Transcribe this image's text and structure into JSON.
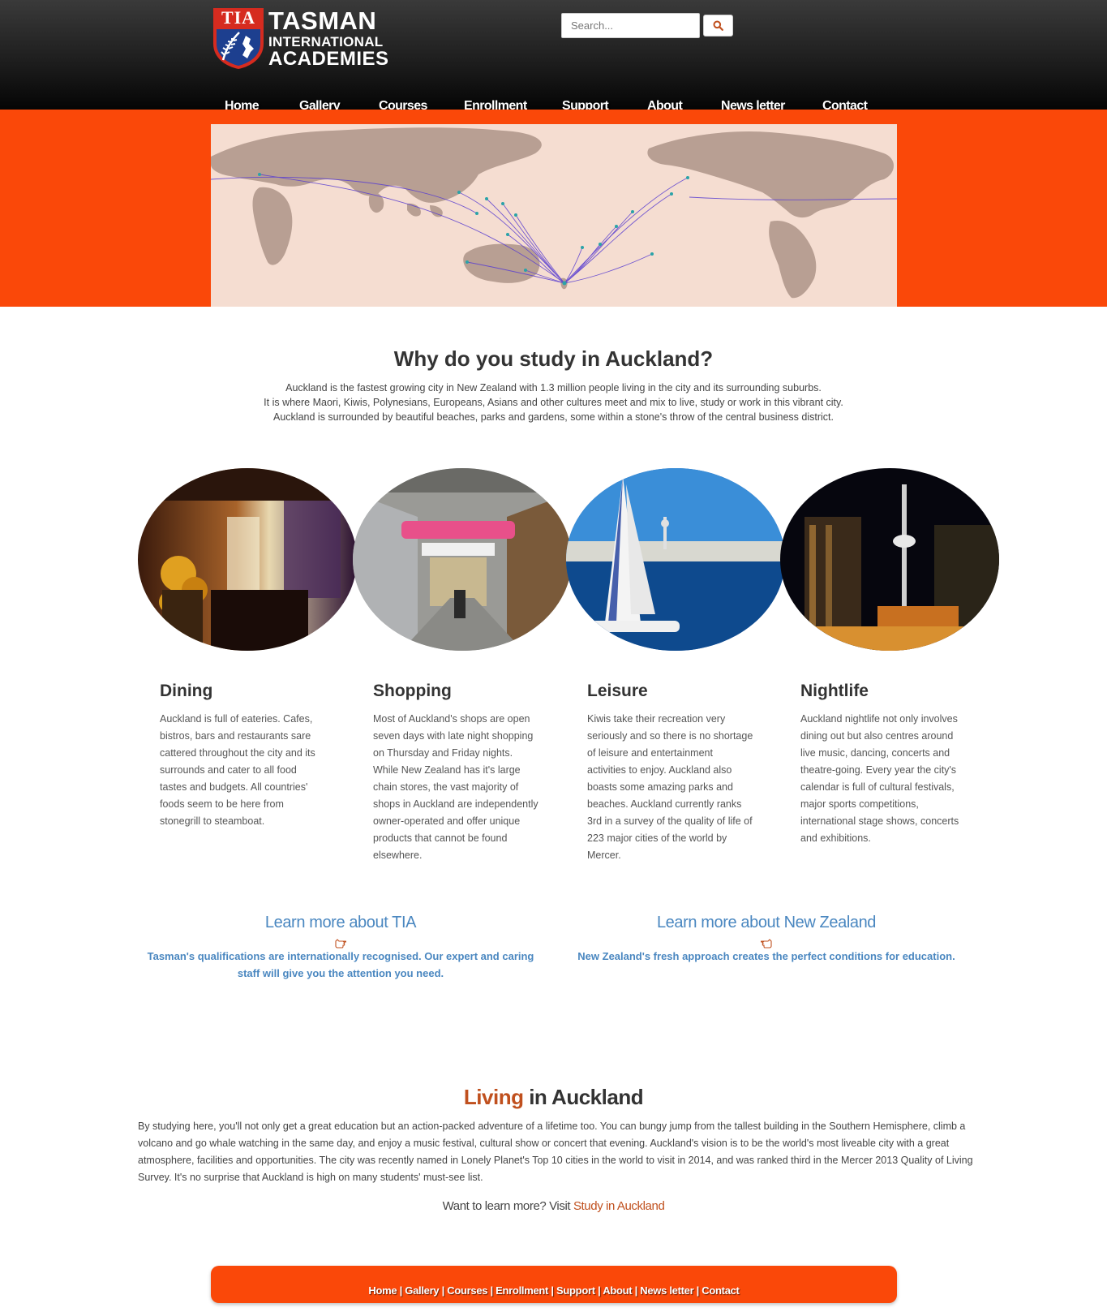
{
  "header": {
    "logo": {
      "badge": "TIA",
      "line1": "TASMAN",
      "line2": "INTERNATIONAL",
      "line3": "ACADEMIES"
    },
    "search": {
      "placeholder": "Search...",
      "button_icon": "search-icon"
    },
    "nav": [
      "Home",
      "Gallery",
      "Courses",
      "Enrollment",
      "Support",
      "About",
      "News letter",
      "Contact"
    ]
  },
  "colors": {
    "accent": "#fa4809",
    "link": "#4a87c0",
    "highlight": "#c0501e"
  },
  "intro": {
    "title": "Why do you study in Auckland?",
    "lines": [
      "Auckland is the fastest growing city in New Zealand with 1.3 million people living in the city and its surrounding suburbs.",
      "It is where Maori, Kiwis, Polynesians, Europeans, Asians and other cultures meet and mix to live, study or work in this vibrant city.",
      "Auckland is surrounded by beautiful beaches, parks and gardens, some within a stone's throw of the central business district."
    ]
  },
  "features": [
    {
      "title": "Dining",
      "text": "Auckland is full of eateries. Cafes, bistros, bars and restaurants sare cattered throughout the city and its surrounds and cater to all food tastes and budgets. All countries' foods seem to be here from stonegrill to steamboat."
    },
    {
      "title": "Shopping",
      "text": "Most of Auckland's shops are open seven days with late night shopping on Thursday and Friday nights. While New Zealand has it's large chain stores, the vast majority of shops in Auckland are independently owner-operated and offer unique products that cannot be found elsewhere."
    },
    {
      "title": "Leisure",
      "text": "Kiwis take their recreation very seriously and so there is no shortage of leisure and entertainment activities to enjoy. Auckland also boasts some amazing parks and beaches. Auckland currently ranks 3rd in a survey of the quality of life of 223 major cities of the world by Mercer."
    },
    {
      "title": "Nightlife",
      "text": "Auckland nightlife not only involves dining out but also centres around live music, dancing, concerts and theatre-going. Every year the city's calendar is full of cultural festivals, major sports competitions, international stage shows, concerts and exhibitions."
    }
  ],
  "learn": [
    {
      "title": "Learn more about TIA",
      "text": "Tasman's qualifications are internationally recognised. Our expert and caring staff will give you the attention you need.",
      "icon": "hand-point-left-icon"
    },
    {
      "title": "Learn more about New Zealand",
      "text": "New Zealand's fresh approach creates the perfect conditions for education.",
      "icon": "hand-point-right-icon"
    }
  ],
  "living": {
    "title_accent": "Living",
    "title_rest": " in Auckland",
    "text": "By studying here, you'll not only get a great education but an action-packed adventure of a lifetime too. You can bungy jump from the tallest building in the Southern Hemisphere, climb a volcano and go whale watching in the same day, and enjoy a music festival, cultural show or concert that evening. Auckland's vision is to be the world's most liveable city with a great atmosphere, facilities and opportunities. The city was recently named in Lonely Planet's Top 10 cities in the world to visit in 2014, and was ranked third in the Mercer 2013 Quality of Living Survey. It's no surprise that Auckland is high on many students' must-see list.",
    "visit_prefix": "Want to learn more? Visit ",
    "visit_link": "Study in Auckland"
  },
  "footer": {
    "links": [
      "Home",
      "Gallery",
      "Courses",
      "Enrollment",
      "Support",
      "About",
      "News letter",
      "Contact"
    ],
    "separator": " | "
  }
}
